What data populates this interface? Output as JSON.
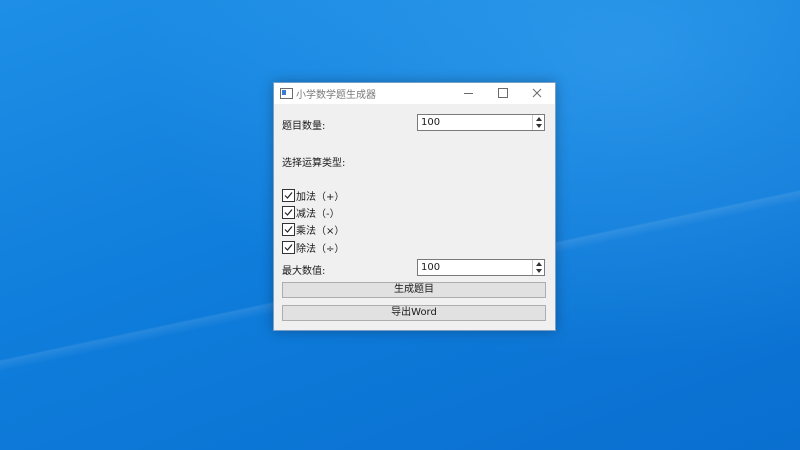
{
  "window": {
    "title": "小学数学题生成器"
  },
  "form": {
    "count_label": "题目数量:",
    "count_value": "100",
    "ops_label": "选择运算类型:",
    "max_label": "最大数值:",
    "max_value": "100"
  },
  "operations": [
    {
      "label": "加法（+）",
      "checked": true
    },
    {
      "label": "减法（-）",
      "checked": true
    },
    {
      "label": "乘法（×）",
      "checked": true
    },
    {
      "label": "除法（÷）",
      "checked": true
    }
  ],
  "buttons": {
    "generate": "生成题目",
    "export": "导出Word"
  },
  "colors": {
    "desktop": "#0f7ddb",
    "window_bg": "#f0f0f0",
    "button_bg": "#e1e1e1"
  }
}
